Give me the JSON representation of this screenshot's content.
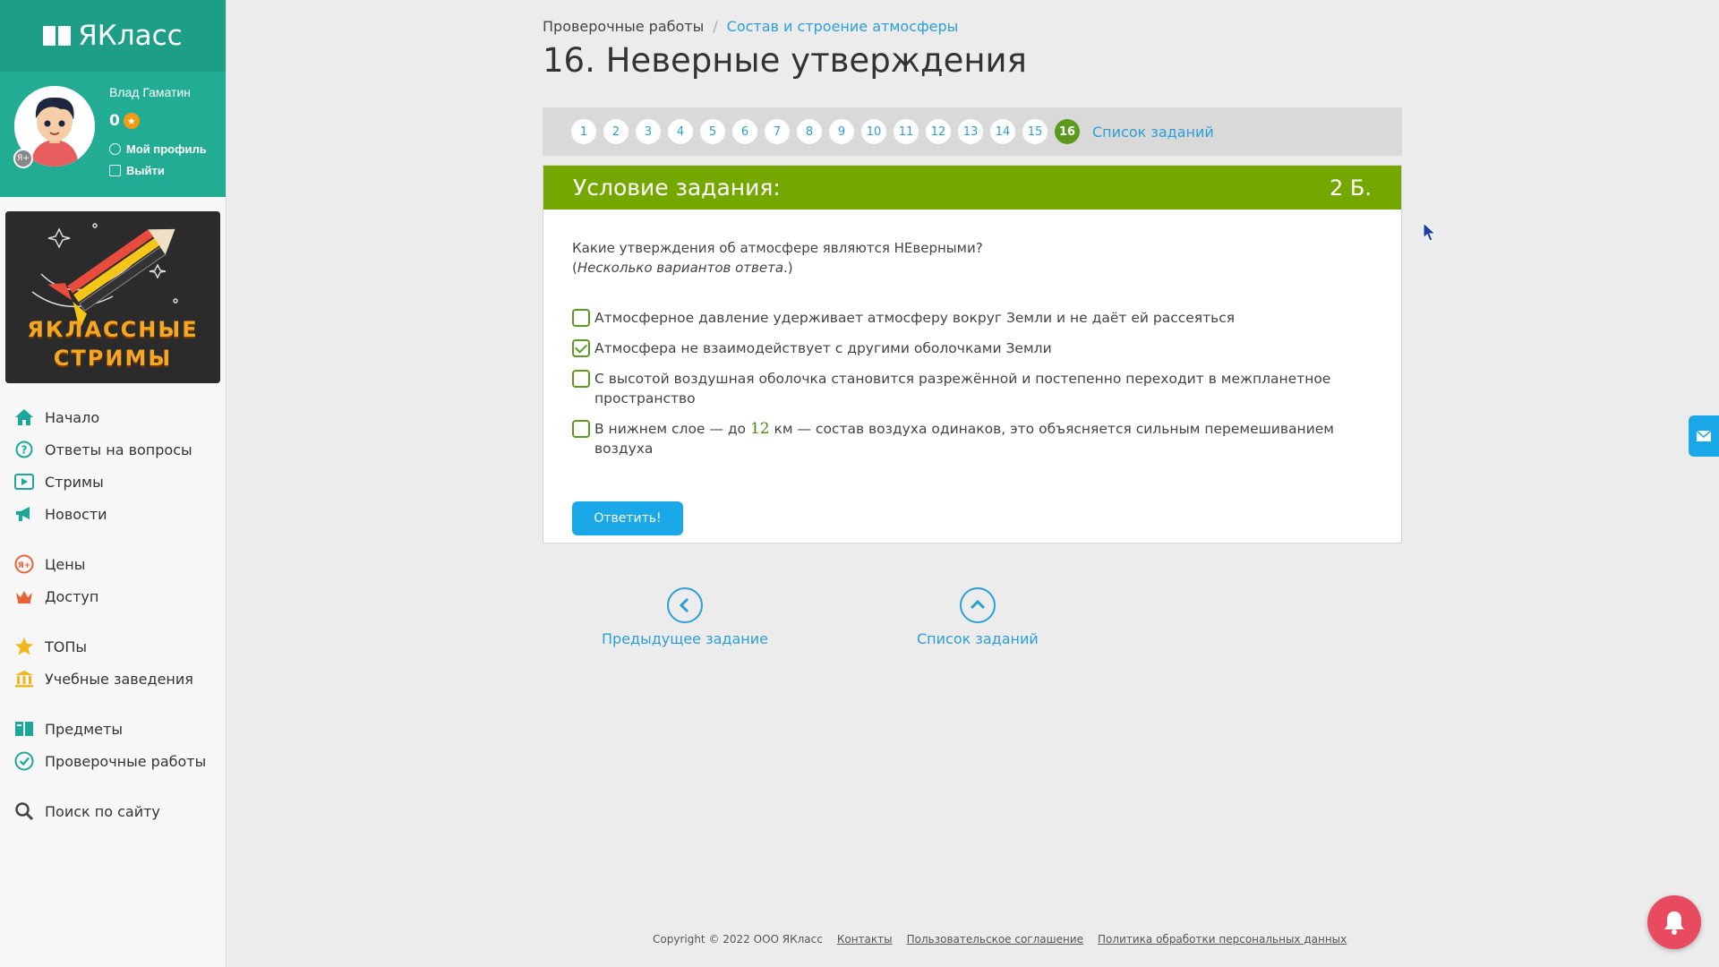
{
  "sidebar": {
    "logo_text": "ЯКласс",
    "user": {
      "name": "Влад Гаматин",
      "points": "0",
      "badge": "Я+",
      "profile_link": "Мой профиль",
      "logout_link": "Выйти"
    },
    "promo": {
      "line1": "ЯКЛАССНЫЕ",
      "line2": "СТРИМЫ"
    },
    "menu": [
      {
        "label": "Начало",
        "icon": "home-icon"
      },
      {
        "label": "Ответы на вопросы",
        "icon": "question-icon"
      },
      {
        "label": "Стримы",
        "icon": "play-icon"
      },
      {
        "label": "Новости",
        "icon": "megaphone-icon"
      },
      {
        "label": "Цены",
        "icon": "yaplus-icon"
      },
      {
        "label": "Доступ",
        "icon": "crown-icon"
      },
      {
        "label": "ТОПы",
        "icon": "star-icon"
      },
      {
        "label": "Учебные заведения",
        "icon": "institution-icon"
      },
      {
        "label": "Предметы",
        "icon": "books-icon"
      },
      {
        "label": "Проверочные работы",
        "icon": "check-circle-icon"
      },
      {
        "label": "Поиск по сайту",
        "icon": "search-icon"
      }
    ]
  },
  "breadcrumb": {
    "root": "Проверочные работы",
    "current": "Состав и строение атмосферы"
  },
  "title": "16. Неверные утверждения",
  "pager": {
    "pages": [
      "1",
      "2",
      "3",
      "4",
      "5",
      "6",
      "7",
      "8",
      "9",
      "10",
      "11",
      "12",
      "13",
      "14",
      "15",
      "16"
    ],
    "active": "16",
    "list_link": "Список заданий"
  },
  "task": {
    "header": "Условие задания:",
    "score": "2 Б.",
    "question": "Какие утверждения об атмосфере являются НЕверными?",
    "hint_open": "(",
    "hint": "Несколько вариантов ответа",
    "hint_close": ".)",
    "options": [
      {
        "text": "Атмосферное давление удерживает атмосферу вокруг Земли и не даёт ей рассеяться",
        "checked": false
      },
      {
        "text": "Атмосфера не взаимодействует с другими оболочками Земли",
        "checked": true
      },
      {
        "text": "С высотой воздушная оболочка становится разрежённой и постепенно переходит в межпланетное пространство",
        "checked": false
      },
      {
        "text_before": "В нижнем слое — до ",
        "number": "12",
        "text_after": " км — состав воздуха одинаков, это объясняется сильным перемешиванием воздуха",
        "checked": false
      }
    ],
    "submit": "Ответить!"
  },
  "nav": {
    "prev": "Предыдущее задание",
    "list": "Список заданий"
  },
  "footer": {
    "copyright": "Copyright © 2022 ООО ЯКласс",
    "links": [
      "Контакты",
      "Пользовательское соглашение",
      "Политика обработки персональных данных"
    ]
  },
  "colors": {
    "brand": "#22ac93",
    "task_header": "#74a800",
    "link": "#2a9fd6",
    "button": "#1ba8e8",
    "bell": "#e84a5f"
  }
}
